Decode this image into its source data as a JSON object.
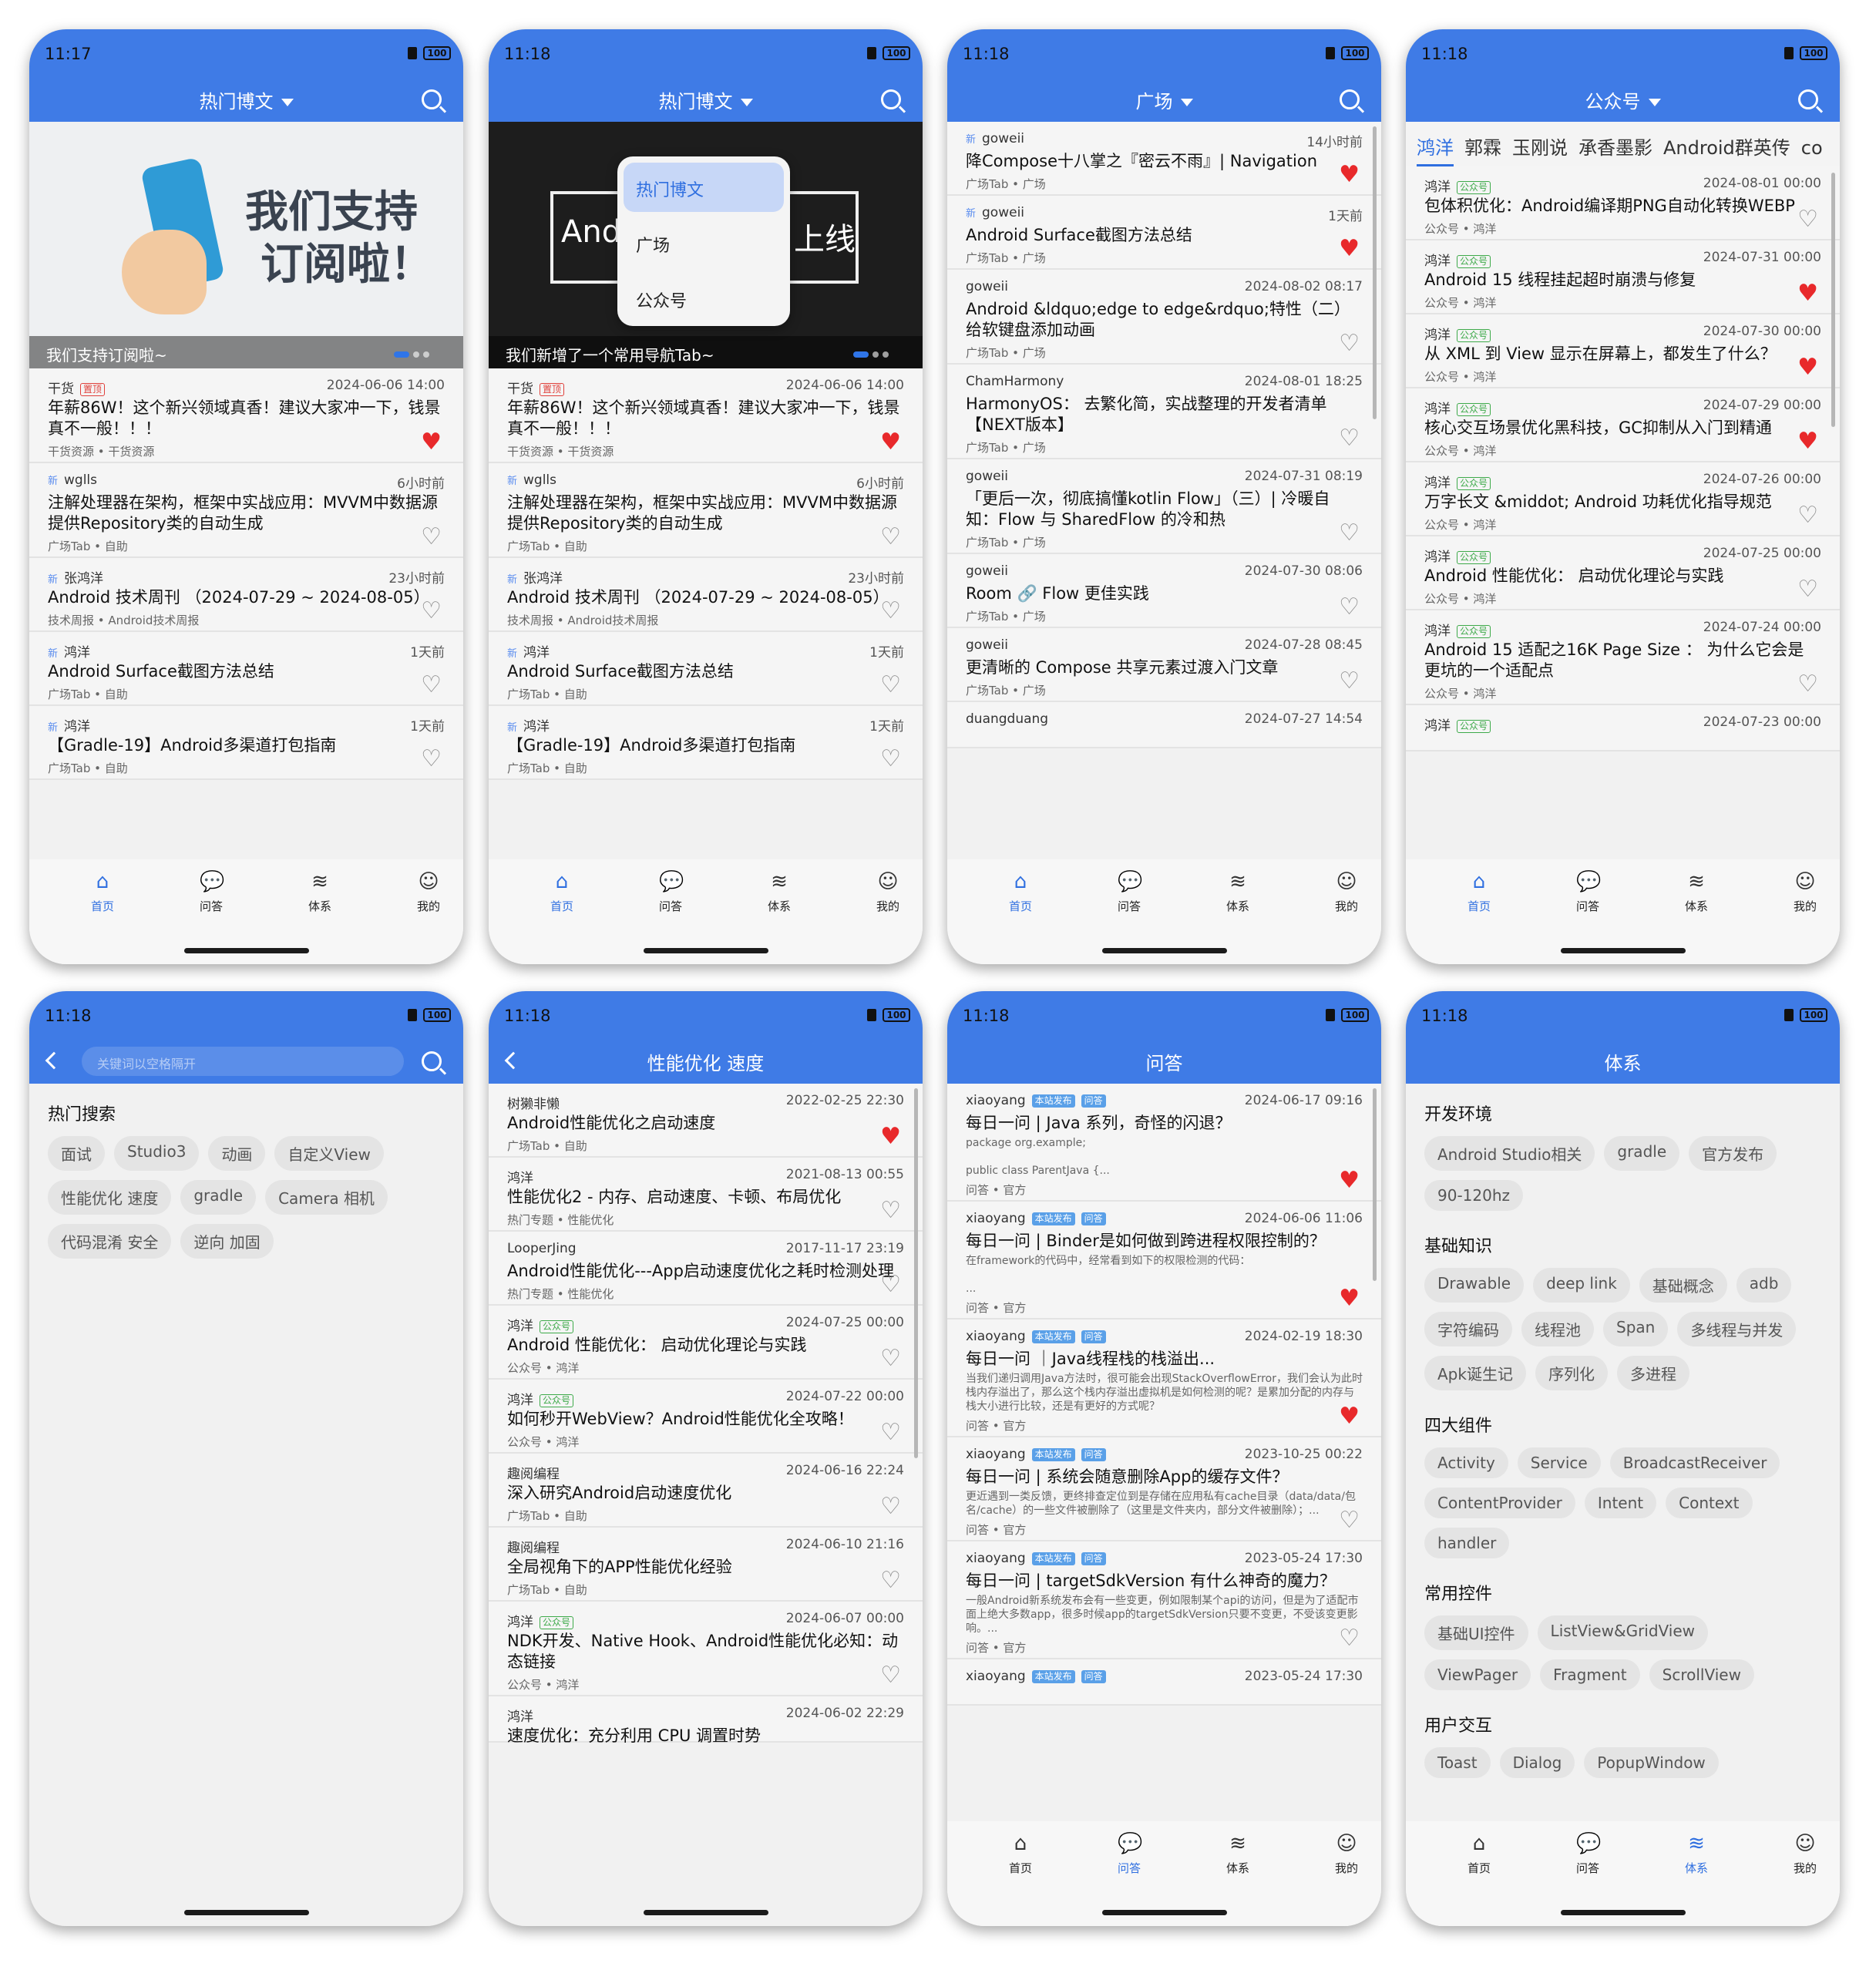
{
  "status": {
    "battery": "100"
  },
  "tabbar": [
    {
      "label": "首页",
      "icon": "home-icon"
    },
    {
      "label": "问答",
      "icon": "chat-icon"
    },
    {
      "label": "体系",
      "icon": "layers-icon"
    },
    {
      "label": "我的",
      "icon": "profile-icon"
    }
  ],
  "screens": {
    "s1": {
      "time": "11:17",
      "title": "热门博文",
      "banner_caption": "我们支持订阅啦~",
      "banner_line1": "我们支持",
      "banner_line2": "订阅啦！",
      "items": [
        {
          "author": "干货",
          "tag": "置顶",
          "time": "2024-06-06 14:00",
          "title": "年薪86W！这个新兴领域真香！建议大家冲一下，钱景真不一般！！！",
          "meta": "干货资源 • 干货资源",
          "liked": true
        },
        {
          "new": "新",
          "author": "wglls",
          "time": "6小时前",
          "title": "注解处理器在架构，框架中实战应用：MVVM中数据源提供Repository类的自动生成",
          "meta": "广场Tab • 自助",
          "liked": false
        },
        {
          "new": "新",
          "author": "张鸿洋",
          "time": "23小时前",
          "title": "Android 技术周刊 （2024-07-29 ~ 2024-08-05）",
          "meta": "技术周报 • Android技术周报",
          "liked": false
        },
        {
          "new": "新",
          "author": "鸿洋",
          "time": "1天前",
          "title": "Android Surface截图方法总结",
          "meta": "广场Tab • 自助",
          "liked": false
        },
        {
          "new": "新",
          "author": "鸿洋",
          "time": "1天前",
          "title": "【Gradle-19】Android多渠道打包指南",
          "meta": "广场Tab • 自助",
          "liked": false
        }
      ]
    },
    "s2": {
      "time": "11:18",
      "title": "热门博文",
      "banner_caption": "我们新增了一个常用导航Tab~",
      "banner_left": "And",
      "banner_right": "上线",
      "dropdown": [
        "热门博文",
        "广场",
        "公众号"
      ],
      "items": [
        {
          "author": "干货",
          "tag": "置顶",
          "time": "2024-06-06 14:00",
          "title": "年薪86W！这个新兴领域真香！建议大家冲一下，钱景真不一般！！！",
          "meta": "干货资源 • 干货资源",
          "liked": true
        },
        {
          "new": "新",
          "author": "wglls",
          "time": "6小时前",
          "title": "注解处理器在架构，框架中实战应用：MVVM中数据源提供Repository类的自动生成",
          "meta": "广场Tab • 自助",
          "liked": false
        },
        {
          "new": "新",
          "author": "张鸿洋",
          "time": "23小时前",
          "title": "Android 技术周刊 （2024-07-29 ~ 2024-08-05）",
          "meta": "技术周报 • Android技术周报",
          "liked": false
        },
        {
          "new": "新",
          "author": "鸿洋",
          "time": "1天前",
          "title": "Android Surface截图方法总结",
          "meta": "广场Tab • 自助",
          "liked": false
        },
        {
          "new": "新",
          "author": "鸿洋",
          "time": "1天前",
          "title": "【Gradle-19】Android多渠道打包指南",
          "meta": "广场Tab • 自助",
          "liked": false
        }
      ]
    },
    "s3": {
      "time": "11:18",
      "title": "广场",
      "items": [
        {
          "new": "新",
          "author": "goweii",
          "time": "14小时前",
          "title": "降Compose十八掌之『密云不雨』| Navigation",
          "meta": "广场Tab • 广场",
          "liked": true
        },
        {
          "new": "新",
          "author": "goweii",
          "time": "1天前",
          "title": "Android Surface截图方法总结",
          "meta": "广场Tab • 广场",
          "liked": true
        },
        {
          "author": "goweii",
          "time": "2024-08-02 08:17",
          "title": "Android &ldquo;edge to edge&rdquo;特性（二）给软键盘添加动画",
          "meta": "广场Tab • 广场",
          "liked": false
        },
        {
          "author": "ChamHarmony",
          "time": "2024-08-01 18:25",
          "title": "HarmonyOS： 去繁化简，实战整理的开发者清单【NEXT版本】",
          "meta": "广场Tab • 广场",
          "liked": false
        },
        {
          "author": "goweii",
          "time": "2024-07-31 08:19",
          "title": "「更后一次，彻底搞懂kotlin Flow」（三）| 冷暖自知：Flow 与 SharedFlow 的冷和热",
          "meta": "广场Tab • 广场",
          "liked": false
        },
        {
          "author": "goweii",
          "time": "2024-07-30 08:06",
          "title": "Room 🔗 Flow 更佳实践",
          "meta": "广场Tab • 广场",
          "liked": false
        },
        {
          "author": "goweii",
          "time": "2024-07-28 08:45",
          "title": "更清晰的 Compose 共享元素过渡入门文章",
          "meta": "广场Tab • 广场",
          "liked": false
        },
        {
          "author": "duangduang",
          "time": "2024-07-27 14:54",
          "title": "",
          "meta": "",
          "liked": false
        }
      ]
    },
    "s4": {
      "time": "11:18",
      "title": "公众号",
      "tabs": [
        "鸿洋",
        "郭霖",
        "玉刚说",
        "承香墨影",
        "Android群英传",
        "co"
      ],
      "items": [
        {
          "author": "鸿洋",
          "tag": "公众号",
          "time": "2024-08-01 00:00",
          "title": "包体积优化：Android编译期PNG自动化转换WEBP",
          "meta": "公众号 • 鸿洋",
          "liked": false
        },
        {
          "author": "鸿洋",
          "tag": "公众号",
          "time": "2024-07-31 00:00",
          "title": "Android 15 线程挂起超时崩溃与修复",
          "meta": "公众号 • 鸿洋",
          "liked": true
        },
        {
          "author": "鸿洋",
          "tag": "公众号",
          "time": "2024-07-30 00:00",
          "title": "从 XML 到 View 显示在屏幕上，都发生了什么？",
          "meta": "公众号 • 鸿洋",
          "liked": true
        },
        {
          "author": "鸿洋",
          "tag": "公众号",
          "time": "2024-07-29 00:00",
          "title": "核心交互场景优化黑科技，GC抑制从入门到精通",
          "meta": "公众号 • 鸿洋",
          "liked": true
        },
        {
          "author": "鸿洋",
          "tag": "公众号",
          "time": "2024-07-26 00:00",
          "title": "万字长文 &middot; Android 功耗优化指导规范",
          "meta": "公众号 • 鸿洋",
          "liked": false
        },
        {
          "author": "鸿洋",
          "tag": "公众号",
          "time": "2024-07-25 00:00",
          "title": "Android 性能优化： 启动优化理论与实践",
          "meta": "公众号 • 鸿洋",
          "liked": false
        },
        {
          "author": "鸿洋",
          "tag": "公众号",
          "time": "2024-07-24 00:00",
          "title": "Android 15 适配之16K Page Size ： 为什么它会是更坑的一个适配点",
          "meta": "公众号 • 鸿洋",
          "liked": false
        },
        {
          "author": "鸿洋",
          "tag": "公众号",
          "time": "2024-07-23 00:00",
          "title": "",
          "meta": "",
          "liked": false
        }
      ]
    },
    "s5": {
      "time": "11:18",
      "search_placeholder": "关键词以空格隔开",
      "hot_title": "热门搜索",
      "hot": [
        "面试",
        "Studio3",
        "动画",
        "自定义View",
        "性能优化 速度",
        "gradle",
        "Camera 相机",
        "代码混淆 安全",
        "逆向 加固"
      ]
    },
    "s6": {
      "time": "11:18",
      "title": "性能优化 速度",
      "items": [
        {
          "author": "树獭非懒",
          "time": "2022-02-25 22:30",
          "title": "Android性能优化之启动速度",
          "meta": "广场Tab • 自助",
          "liked": true
        },
        {
          "author": "鸿洋",
          "time": "2021-08-13 00:55",
          "title": "性能优化2 - 内存、启动速度、卡顿、布局优化",
          "meta": "热门专题 • 性能优化",
          "liked": false
        },
        {
          "author": "LooperJing",
          "time": "2017-11-17 23:19",
          "title": "Android性能优化---App启动速度优化之耗时检测处理",
          "meta": "热门专题 • 性能优化",
          "liked": false
        },
        {
          "author": "鸿洋",
          "tag": "公众号",
          "time": "2024-07-25 00:00",
          "title": "Android 性能优化： 启动优化理论与实践",
          "meta": "公众号 • 鸿洋",
          "liked": false
        },
        {
          "author": "鸿洋",
          "tag": "公众号",
          "time": "2024-07-22 00:00",
          "title": "如何秒开WebView？Android性能优化全攻略！",
          "meta": "公众号 • 鸿洋",
          "liked": false
        },
        {
          "author": "趣阅编程",
          "time": "2024-06-16 22:24",
          "title": "深入研究Android启动速度优化",
          "meta": "广场Tab • 自助",
          "liked": false
        },
        {
          "author": "趣阅编程",
          "time": "2024-06-10 21:16",
          "title": "全局视角下的APP性能优化经验",
          "meta": "广场Tab • 自助",
          "liked": false
        },
        {
          "author": "鸿洋",
          "tag": "公众号",
          "time": "2024-06-07 00:00",
          "title": "NDK开发、Native Hook、Android性能优化必知：动态链接",
          "meta": "公众号 • 鸿洋",
          "liked": false
        },
        {
          "author": "鸿洋",
          "time": "2024-06-02 22:29",
          "title": "速度优化：充分利用 CPU 调置时势",
          "meta": "",
          "liked": false
        }
      ]
    },
    "s7": {
      "time": "11:18",
      "title": "问答",
      "tag1": "本站发布",
      "tag2": "问答",
      "items": [
        {
          "author": "xiaoyang",
          "time": "2024-06-17 09:16",
          "title": "每日一问 | Java 系列，奇怪的闪退？",
          "desc": "package org.example;\n\npublic class ParentJava {...",
          "meta": "问答 • 官方",
          "liked": true
        },
        {
          "author": "xiaoyang",
          "time": "2024-06-06 11:06",
          "title": "每日一问 | Binder是如何做到跨进程权限控制的？",
          "desc": "在framework的代码中，经常看到如下的权限检测的代码：\n\n...",
          "meta": "问答 • 官方",
          "liked": true
        },
        {
          "author": "xiaoyang",
          "time": "2024-02-19 18:30",
          "title": "每日一问 ｜Java线程栈的栈溢出...",
          "desc": "当我们递归调用Java方法时，很可能会出现StackOverflowError，我们会认为此时栈内存溢出了，那么这个栈内存溢出虚拟机是如何检测的呢？是累加分配的内存与栈大小进行比较，还是有更好的方式呢？",
          "meta": "问答 • 官方",
          "liked": true
        },
        {
          "author": "xiaoyang",
          "time": "2023-10-25 00:22",
          "title": "每日一问 | 系统会随意删除App的缓存文件？",
          "desc": "更近遇到一类反馈，更终排查定位到是存储在应用私有cache目录（data/data/包名/cache）的一些文件被删除了（这里是文件夹内，部分文件被删除）；...",
          "meta": "问答 • 官方",
          "liked": false
        },
        {
          "author": "xiaoyang",
          "time": "2023-05-24 17:30",
          "title": "每日一问 | targetSdkVersion 有什么神奇的魔力？",
          "desc": "一般Android新系统发布会有一些变更，例如限制某个api的访问，但是为了适配市面上绝大多数app，很多时候app的targetSdkVersion只要不变更，不受该变更影响。...",
          "meta": "问答 • 官方",
          "liked": false
        },
        {
          "author": "xiaoyang",
          "time": "2023-05-24 17:30",
          "title": "",
          "desc": "",
          "meta": "",
          "liked": false
        }
      ]
    },
    "s8": {
      "time": "11:18",
      "title": "体系",
      "sections": [
        {
          "title": "开发环境",
          "chips": [
            "Android Studio相关",
            "gradle",
            "官方发布",
            "90-120hz"
          ]
        },
        {
          "title": "基础知识",
          "chips": [
            "Drawable",
            "deep link",
            "基础概念",
            "adb",
            "字符编码",
            "线程池",
            "Span",
            "多线程与并发",
            "Apk诞生记",
            "序列化",
            "多进程"
          ]
        },
        {
          "title": "四大组件",
          "chips": [
            "Activity",
            "Service",
            "BroadcastReceiver",
            "ContentProvider",
            "Intent",
            "Context",
            "handler"
          ]
        },
        {
          "title": "常用控件",
          "chips": [
            "基础UI控件",
            "ListView&GridView",
            "ViewPager",
            "Fragment",
            "ScrollView"
          ]
        },
        {
          "title": "用户交互",
          "chips": [
            "Toast",
            "Dialog",
            "PopupWindow"
          ]
        }
      ]
    }
  }
}
